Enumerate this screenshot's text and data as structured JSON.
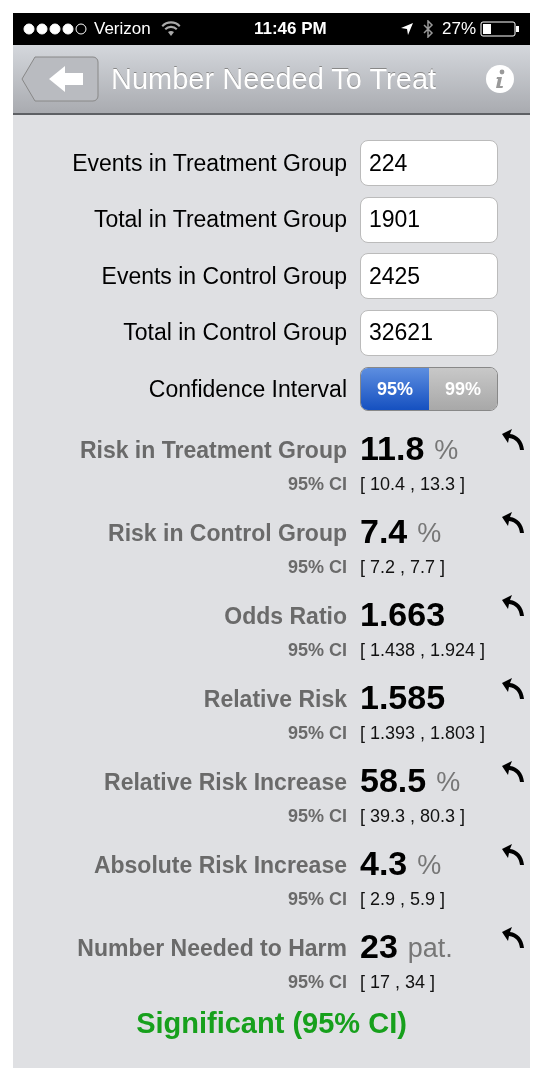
{
  "status_bar": {
    "carrier": "Verizon",
    "time": "11:46 PM",
    "battery": "27%"
  },
  "nav": {
    "title": "Number Needed To Treat"
  },
  "inputs": [
    {
      "label": "Events in Treatment Group",
      "value": "224"
    },
    {
      "label": "Total in Treatment Group",
      "value": "1901"
    },
    {
      "label": "Events in Control Group",
      "value": "2425"
    },
    {
      "label": "Total in Control Group",
      "value": "32621"
    }
  ],
  "confidence": {
    "label": "Confidence Interval",
    "options": [
      {
        "label": "95%",
        "selected": true
      },
      {
        "label": "99%",
        "selected": false
      }
    ]
  },
  "results": [
    {
      "label": "Risk in Treatment Group",
      "value": "11.8",
      "unit": "%",
      "ci_label": "95% CI",
      "ci": "[ 10.4 , 13.3 ]"
    },
    {
      "label": "Risk in Control Group",
      "value": "7.4",
      "unit": "%",
      "ci_label": "95% CI",
      "ci": "[ 7.2 , 7.7 ]"
    },
    {
      "label": "Odds Ratio",
      "value": "1.663",
      "ci_label": "95% CI",
      "ci": "[ 1.438 , 1.924 ]"
    },
    {
      "label": "Relative Risk",
      "value": "1.585",
      "ci_label": "95% CI",
      "ci": "[ 1.393 , 1.803 ]"
    },
    {
      "label": "Relative Risk Increase",
      "value": "58.5",
      "unit": "%",
      "ci_label": "95% CI",
      "ci": "[ 39.3 , 80.3 ]"
    },
    {
      "label": "Absolute Risk Increase",
      "value": "4.3",
      "unit": "%",
      "ci_label": "95% CI",
      "ci": "[ 2.9 , 5.9 ]"
    },
    {
      "label": "Number Needed to Harm",
      "value": "23",
      "unit": "pat.",
      "ci_label": "95% CI",
      "ci": "[ 17 , 34 ]"
    }
  ],
  "verdict": {
    "text": "Significant (95% CI)",
    "significant": true
  }
}
